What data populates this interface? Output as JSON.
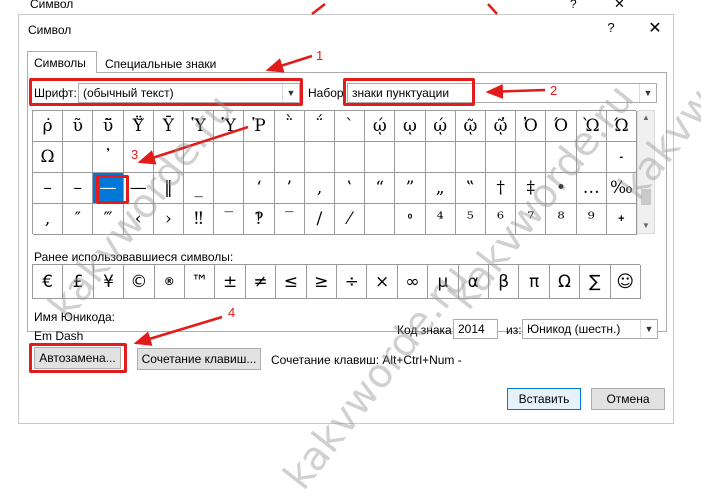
{
  "background_window": {
    "title": "Символ",
    "help": "?",
    "close": "✕"
  },
  "dialog": {
    "title": "Символ",
    "help": "?",
    "close": "✕",
    "tabs": [
      "Символы",
      "Специальные знаки"
    ],
    "font": {
      "label": "Шрифт:",
      "value": "(обычный текст)"
    },
    "subset": {
      "label": "Набор:",
      "value": "знаки пунктуации"
    },
    "grid": [
      [
        "ρ̇",
        "ῦ",
        "ῦ̈",
        "Ϋ̆",
        "Ῡ",
        "Ὑ",
        "Ὑ",
        "Ῥ",
        "῭",
        "΅",
        "`",
        "ῴ",
        "ῳ",
        "ῴ",
        "ῷ",
        "ῷ̔",
        "Ὀ",
        "Ό",
        "Ὼ",
        "Ώ"
      ],
      [
        "Ω",
        "",
        "᾽",
        "",
        "",
        "",
        "",
        "",
        "",
        "",
        "",
        "",
        "",
        "",
        "",
        "",
        "",
        "",
        "",
        "-"
      ],
      [
        "–",
        "–",
        "—",
        "—",
        "‖",
        "_",
        "",
        "‘",
        "’",
        "‚",
        "‛",
        "“",
        "”",
        "„",
        "‟",
        "†",
        "‡",
        "•",
        "…",
        "‰"
      ],
      [
        ",",
        "″",
        "‴",
        "‹",
        "›",
        "‼",
        "‾",
        "‽",
        "‾",
        "/",
        "⁄",
        "",
        "⁰",
        "⁴",
        "⁵",
        "⁶",
        "⁷",
        "⁸",
        "⁹",
        "+"
      ]
    ],
    "selected_cell": {
      "row": 2,
      "col": 2
    },
    "recent_label": "Ранее использовавшиеся символы:",
    "recent": [
      "€",
      "£",
      "¥",
      "©",
      "®",
      "™",
      "±",
      "≠",
      "≤",
      "≥",
      "÷",
      "×",
      "∞",
      "µ",
      "α",
      "β",
      "π",
      "Ω",
      "∑",
      "☺"
    ],
    "unicode_name_label": "Имя Юникода:",
    "unicode_name": "Em Dash",
    "char_code": {
      "label": "Код знака:",
      "value": "2014"
    },
    "from": {
      "label": "из:",
      "value": "Юникод (шестн.)"
    },
    "autocorrect_button": "Автозамена...",
    "shortcut_button": "Сочетание клавиш...",
    "shortcut_text": "Сочетание клавиш: Alt+Ctrl+Num -",
    "insert_button": "Вставить",
    "cancel_button": "Отмена"
  },
  "annotations": {
    "callouts": [
      "1",
      "2",
      "3",
      "4"
    ],
    "color": "#e21b1b"
  },
  "watermark": "kakvworde.ru"
}
